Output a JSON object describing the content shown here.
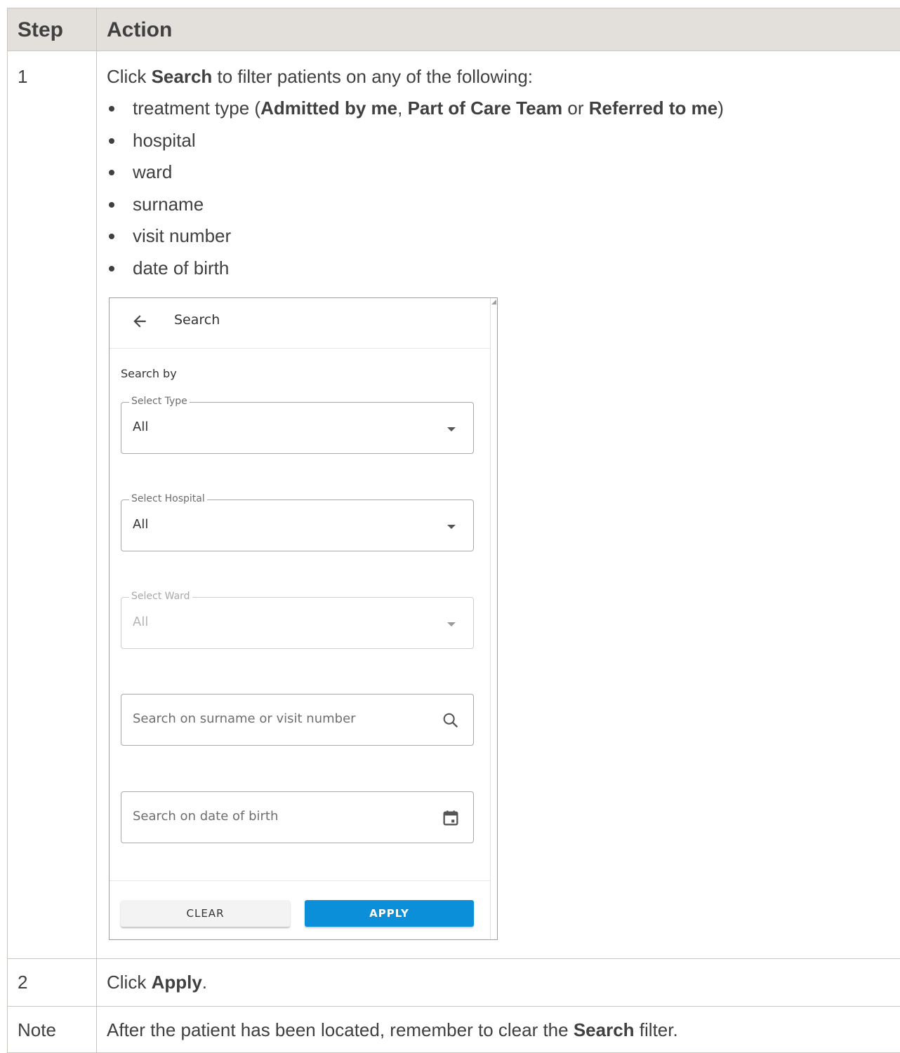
{
  "table": {
    "header": {
      "step": "Step",
      "action": "Action"
    },
    "rows": [
      {
        "step": "1",
        "intro": {
          "pre": "Click ",
          "bold": "Search",
          "post": " to filter patients on any of the following:"
        },
        "bullets": [
          {
            "pre": "treatment type (",
            "b1": "Admitted by me",
            "sep1": ", ",
            "b2": "Part of Care Team",
            "sep2": " or ",
            "b3": "Referred to me",
            "post": ")"
          },
          {
            "text": "hospital"
          },
          {
            "text": "ward"
          },
          {
            "text": "surname"
          },
          {
            "text": "visit number"
          },
          {
            "text": "date of birth"
          }
        ]
      },
      {
        "step": "2",
        "pre": "Click ",
        "bold": "Apply",
        "post": "."
      },
      {
        "step": "Note",
        "pre": "After the patient has been located, remember to clear the ",
        "bold": "Search",
        "post": " filter."
      }
    ]
  },
  "search_panel": {
    "title": "Search",
    "back_icon": "arrow-left-icon",
    "search_by_label": "Search by",
    "fields": {
      "type": {
        "label": "Select Type",
        "value": "All"
      },
      "hospital": {
        "label": "Select Hospital",
        "value": "All"
      },
      "ward": {
        "label": "Select Ward",
        "value": "All",
        "disabled": true
      },
      "surname": {
        "placeholder": "Search on surname or visit number",
        "icon": "search-icon"
      },
      "dob": {
        "placeholder": "Search on date of birth",
        "icon": "calendar-icon"
      }
    },
    "buttons": {
      "clear": "CLEAR",
      "apply": "APPLY"
    },
    "colors": {
      "apply_bg": "#0a8fd8",
      "header_bg": "#e3e0db",
      "border": "#c9c6c1"
    }
  }
}
